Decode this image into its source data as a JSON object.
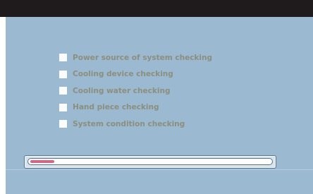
{
  "checklist": {
    "items": [
      {
        "label": "Power source of system checking",
        "checked": false
      },
      {
        "label": "Cooling device checking",
        "checked": false
      },
      {
        "label": "Cooling water checking",
        "checked": false
      },
      {
        "label": "Hand piece checking",
        "checked": false
      },
      {
        "label": "System condition checking",
        "checked": false
      }
    ]
  },
  "progress": {
    "value": 0.1
  },
  "colors": {
    "top_bar": "#1f1b1d",
    "panel": "#9cb9d2",
    "label_text": "#8b8f7d",
    "checkbox": "#fbfcfd",
    "progress_fill": "#de5f88"
  }
}
